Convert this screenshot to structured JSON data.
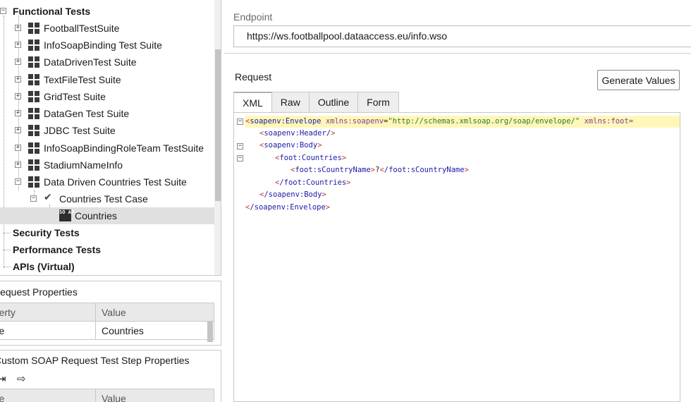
{
  "tree": {
    "root": "Functional Tests",
    "suites": [
      "FootballTestSuite",
      "InfoSoapBinding Test Suite",
      "DataDrivenTest Suite",
      "TextFileTest Suite",
      "GridTest Suite",
      "DataGen Test Suite",
      "JDBC Test Suite",
      "InfoSoapBindingRoleTeam TestSuite",
      "StadiumNameInfo",
      "Data Driven Countries Test Suite"
    ],
    "test_case": "Countries Test Case",
    "test_step": "Countries",
    "soap_icon_text": "SO AP",
    "other_roots": [
      "Security Tests",
      "Performance Tests",
      "APIs (Virtual)"
    ]
  },
  "request_properties": {
    "title": "Request Properties",
    "col_property": "Property",
    "col_value": "Value",
    "rows": [
      {
        "name": "Name",
        "value": "Countries"
      }
    ]
  },
  "custom_properties": {
    "title": "Custom SOAP Request Test Step Properties",
    "col_property": "Name",
    "col_value": "Value"
  },
  "editor": {
    "endpoint_label": "Endpoint",
    "endpoint_value": "https://ws.footballpool.dataaccess.eu/info.wso",
    "request_label": "Request",
    "generate_button": "Generate Values",
    "tabs": [
      "XML",
      "Raw",
      "Outline",
      "Form"
    ],
    "active_tab": "XML",
    "xml": {
      "l1_tag": "soapenv:Envelope",
      "l1_attr1": "xmlns:soapenv",
      "l1_val1": "\"http://schemas.xmlsoap.org/soap/envelope/\"",
      "l1_attr2": "xmlns:foot=",
      "l2_tag": "soapenv:Header/",
      "l3_tag": "soapenv:Body",
      "l4_tag": "foot:Countries",
      "l5_tag": "foot:sCountryName",
      "l5_text": "?",
      "l5_close": "/foot:sCountryName",
      "l6_tag": "/foot:Countries",
      "l7_tag": "/soapenv:Body",
      "l8_tag": "/soapenv:Envelope"
    }
  }
}
